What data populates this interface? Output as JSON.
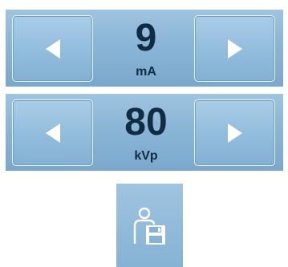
{
  "steppers": {
    "ma": {
      "value": "9",
      "unit": "mA"
    },
    "kvp": {
      "value": "80",
      "unit": "kVp"
    }
  },
  "icons": {
    "decrease": "left-triangle-icon",
    "increase": "right-triangle-icon",
    "save_patient": "person-floppy-disk-icon"
  },
  "colors": {
    "panel": "#8ab5d6",
    "button_border": "#eaf3fa",
    "value_text": "#102b44",
    "arrow": "#ffffff"
  }
}
